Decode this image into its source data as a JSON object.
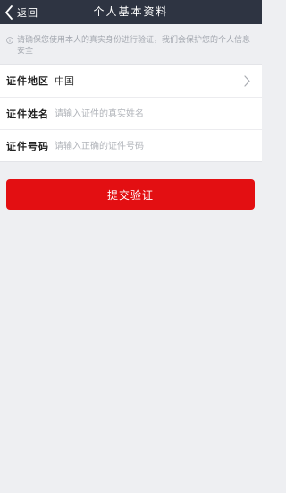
{
  "header": {
    "back_label": "返回",
    "title": "个人基本资料"
  },
  "notice": {
    "icon": "info-icon",
    "text": "请确保您使用本人的真实身份进行验证，我们会保护您的个人信息安全"
  },
  "form": {
    "region": {
      "label": "证件地区",
      "value": "中国",
      "icon": "chevron-right-icon"
    },
    "name": {
      "label": "证件姓名",
      "placeholder": "请输入证件的真实姓名",
      "value": ""
    },
    "id_number": {
      "label": "证件号码",
      "placeholder": "请输入正确的证件号码",
      "value": ""
    }
  },
  "submit_label": "提交验证",
  "colors": {
    "header_bg": "#2e3442",
    "page_bg": "#eeeff2",
    "button_bg": "#e30f12",
    "placeholder": "#b1b4ba"
  }
}
